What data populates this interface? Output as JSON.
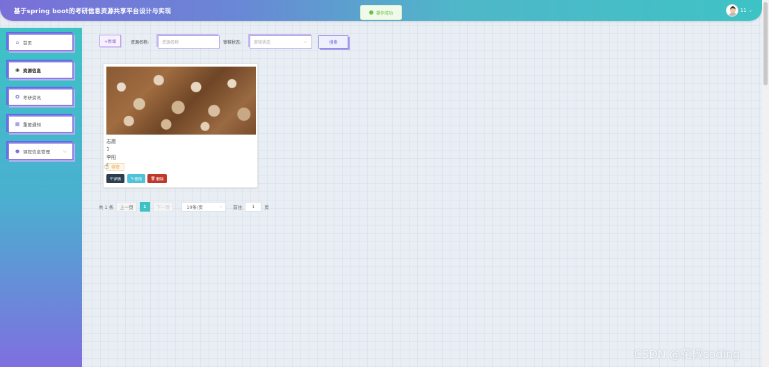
{
  "header": {
    "title": "基于spring boot的考研信息资源共享平台设计与实现",
    "toast": "操作成功",
    "user": "11",
    "user_chevron": "⌵"
  },
  "sidebar": {
    "items": [
      {
        "label": "首页",
        "icon": "home-icon",
        "glyph": "⌂"
      },
      {
        "label": "资源信息",
        "icon": "resource-icon",
        "glyph": "◉"
      },
      {
        "label": "考研资讯",
        "icon": "info-icon",
        "glyph": "✪"
      },
      {
        "label": "重要通知",
        "icon": "notice-icon",
        "glyph": "▦"
      },
      {
        "label": "课程信息管理",
        "icon": "course-icon",
        "glyph": "●"
      }
    ],
    "active_index": 1
  },
  "toolbar": {
    "add_label": "+新增",
    "name_label": "资源名称:",
    "name_placeholder": "资源名称",
    "status_label": "审核状态:",
    "status_placeholder": "审核状态",
    "search_label": "搜索"
  },
  "card": {
    "line1": "志愿",
    "line2": "1",
    "line3": "李阳",
    "tag": "待审",
    "detail_label": "详情",
    "edit_label": "修改",
    "delete_label": "删除"
  },
  "pagination": {
    "total": "共 1 条",
    "prev": "上一页",
    "current": "1",
    "next": "下一页",
    "page_size": "10条/页",
    "goto_label": "前往",
    "goto_value": "1",
    "page_suffix": "页"
  },
  "watermark": "CSDN @花椒coding"
}
